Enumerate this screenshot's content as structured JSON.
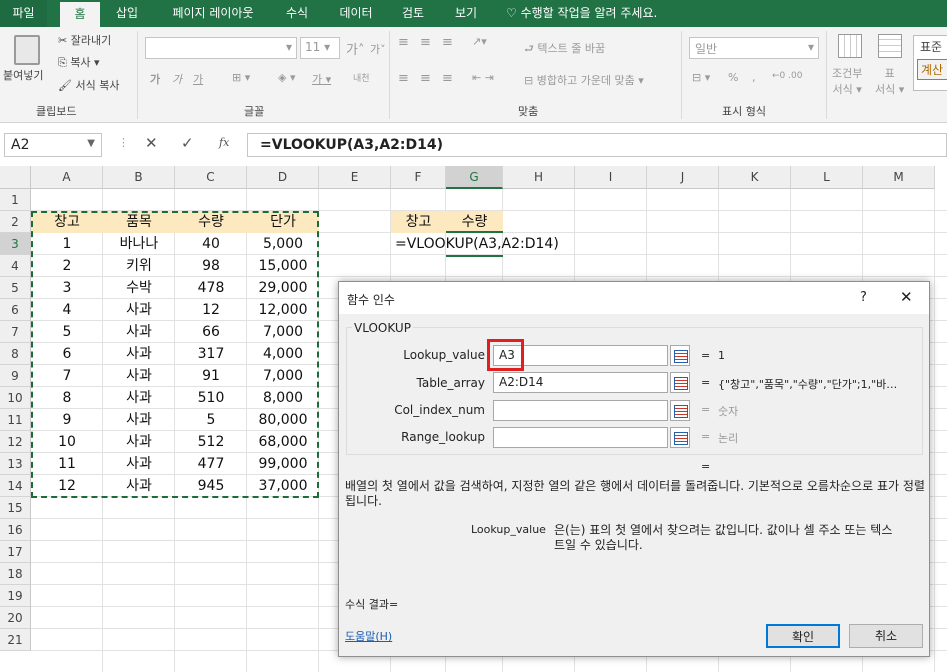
{
  "tabs": [
    "파일",
    "홈",
    "삽입",
    "페이지 레이아웃",
    "수식",
    "데이터",
    "검토",
    "보기",
    "수행할 작업을 알려 주세요."
  ],
  "ribbon": {
    "cut": "잘라내기",
    "copy": "복사",
    "paste": "붙여넣기",
    "format_painter": "서식 복사",
    "clipboard": "클립보드",
    "font_size": "11",
    "font_group": "글꼴",
    "wrap": "텍스트 줄 바꿈",
    "merge": "병합하고 가운데 맞춤",
    "align_group": "맞춤",
    "number_format": "일반",
    "number_group": "표시 형식",
    "conditional": "조건부",
    "conditional2": "서식",
    "table": "표",
    "table2": "서식",
    "style1": "표준",
    "style2": "계산",
    "grow": "가",
    "shrink": "가",
    "bold": "가",
    "italic": "가",
    "underline": "가",
    "fontcolor": "가",
    "percent": "%",
    "comma": ",",
    "phonetic": "내천"
  },
  "formula_bar": {
    "name_box": "A2",
    "formula": "=VLOOKUP(A3,A2:D14)",
    "fx": "fx"
  },
  "columns": [
    "A",
    "B",
    "C",
    "D",
    "E",
    "F",
    "G",
    "H",
    "I",
    "J",
    "K",
    "L",
    "M"
  ],
  "rows": [
    "1",
    "2",
    "3",
    "4",
    "5",
    "6",
    "7",
    "8",
    "9",
    "10",
    "11",
    "12",
    "13",
    "14",
    "15",
    "16",
    "17",
    "18",
    "19",
    "20",
    "21"
  ],
  "table": {
    "headers": [
      "창고",
      "품목",
      "수량",
      "단가"
    ],
    "rows": [
      [
        "1",
        "바나나",
        "40",
        "5,000"
      ],
      [
        "2",
        "키위",
        "98",
        "15,000"
      ],
      [
        "3",
        "수박",
        "478",
        "29,000"
      ],
      [
        "4",
        "사과",
        "12",
        "12,000"
      ],
      [
        "5",
        "사과",
        "66",
        "7,000"
      ],
      [
        "6",
        "사과",
        "317",
        "4,000"
      ],
      [
        "7",
        "사과",
        "91",
        "7,000"
      ],
      [
        "8",
        "사과",
        "510",
        "8,000"
      ],
      [
        "9",
        "사과",
        "5",
        "80,000"
      ],
      [
        "10",
        "사과",
        "512",
        "68,000"
      ],
      [
        "11",
        "사과",
        "477",
        "99,000"
      ],
      [
        "12",
        "사과",
        "945",
        "37,000"
      ]
    ]
  },
  "lookup": {
    "h1": "창고",
    "h2": "수량",
    "editing": "=VLOOKUP(A3,A2:D14)"
  },
  "dialog": {
    "title": "함수 인수",
    "help_q": "?",
    "close": "✕",
    "function": "VLOOKUP",
    "args": [
      {
        "label": "Lookup_value",
        "value": "A3",
        "result": "1"
      },
      {
        "label": "Table_array",
        "value": "A2:D14",
        "result": "{\"창고\",\"품목\",\"수량\",\"단가\";1,\"바…"
      },
      {
        "label": "Col_index_num",
        "value": "",
        "result": "숫자"
      },
      {
        "label": "Range_lookup",
        "value": "",
        "result": "논리"
      }
    ],
    "eq": "=",
    "eqsign": "=",
    "description": "배열의 첫 열에서 값을 검색하여, 지정한 열의 같은 행에서 데이터를 돌려줍니다. 기본적으로 오름차순으로 표가 정렬됩니다.",
    "arg_name": "Lookup_value",
    "arg_desc": "은(는) 표의 첫 열에서 찾으려는 값입니다. 값이나 셀 주소 또는 텍스트일 수 있습니다.",
    "result_label": "수식 결과=",
    "help_link": "도움말(H)",
    "ok": "확인",
    "cancel": "취소"
  },
  "colors": {
    "excel_green": "#217346",
    "highlight": "#e02020",
    "header_fill": "#fde9c0"
  }
}
